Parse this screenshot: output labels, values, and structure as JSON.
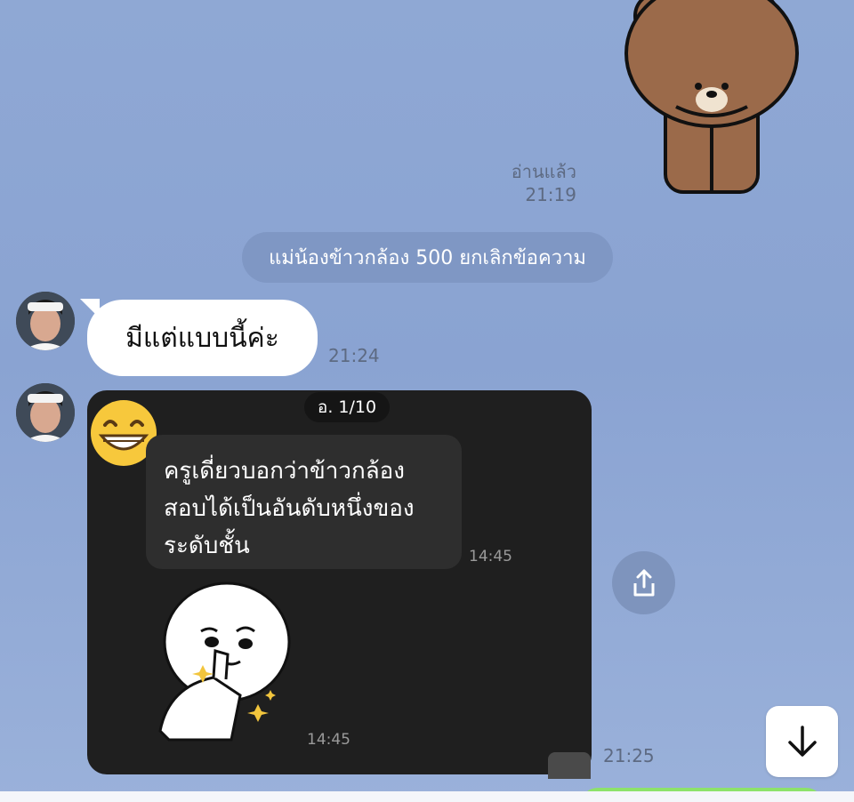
{
  "read_receipt": {
    "status": "อ่านแล้ว",
    "time": "21:19"
  },
  "system_message": "แม่น้องข้าวกล้อง 500 ยกเลิกข้อความ",
  "message1": {
    "text": "มีแต่แบบนี้ค่ะ",
    "time": "21:24"
  },
  "photo": {
    "page_label": "อ. 1/10",
    "inner_message": [
      "ครูเดี่ยวบอกว่าข้าวกล้อง",
      "สอบได้เป็นอันดับหนึ่งของ",
      "ระดับชั้น"
    ],
    "inner_time1": "14:45",
    "inner_time2": "14:45",
    "time": "21:25"
  },
  "icons": {
    "share": "share-icon",
    "scroll_down": "arrow-down-icon",
    "bear_sticker": "bear-sticker",
    "moon_sticker": "moon-sticker",
    "emoji": "grinning-emoji"
  },
  "colors": {
    "background": "#8fa8d4",
    "bubble": "#ffffff",
    "photo_bg": "#1f1f1f",
    "system_pill": "#7f97c4"
  }
}
